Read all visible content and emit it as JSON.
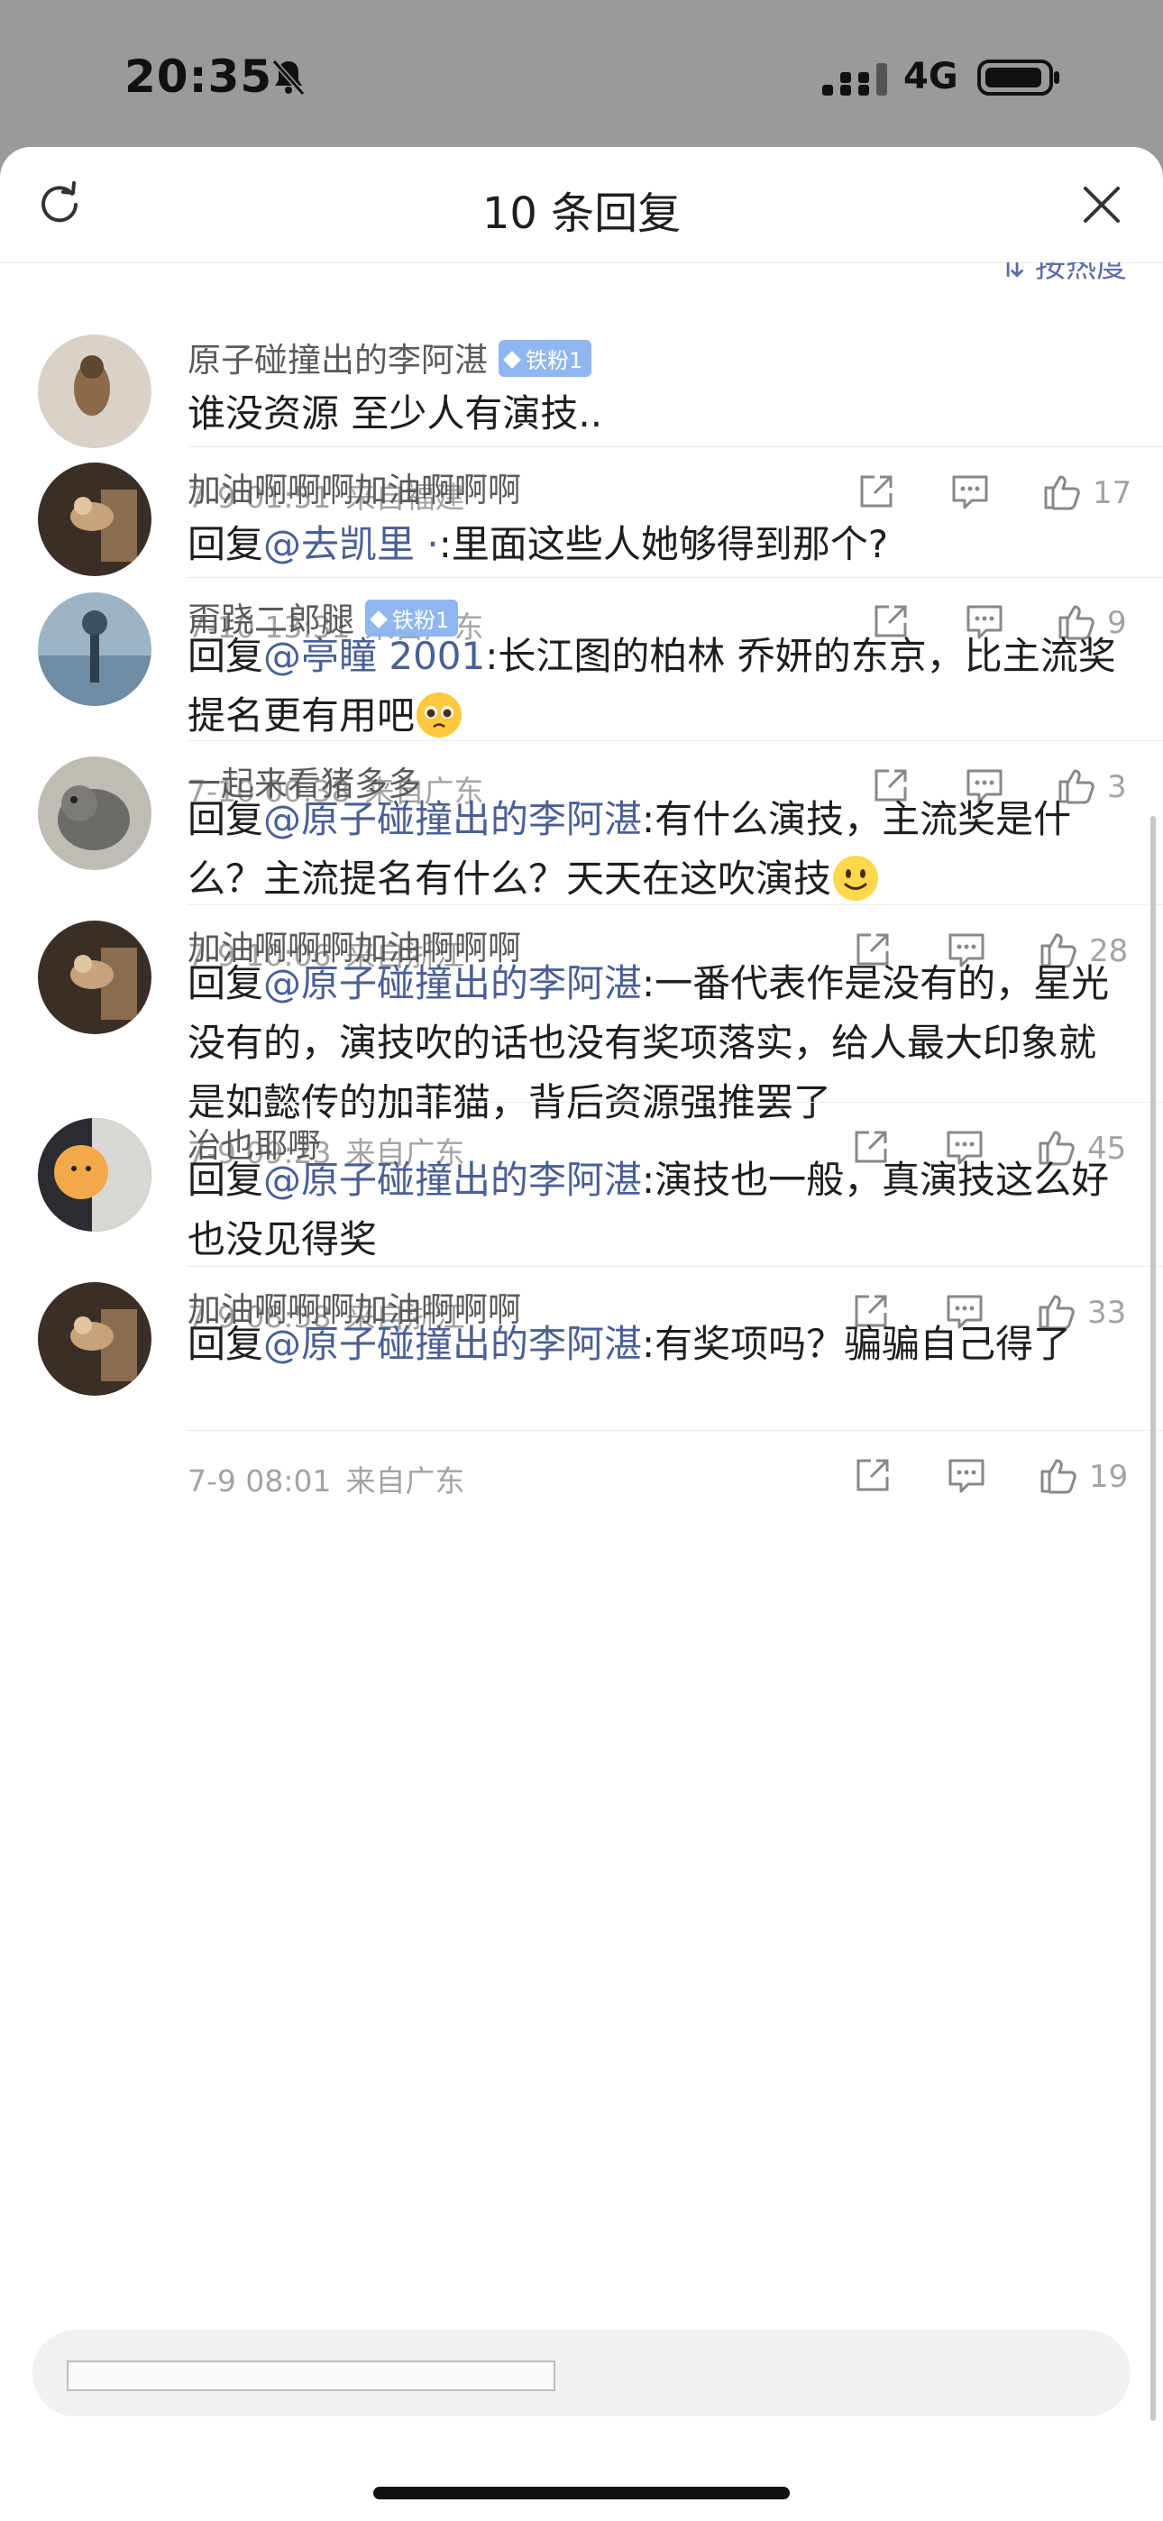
{
  "status": {
    "time": "20:35",
    "network": "4G"
  },
  "sheet": {
    "title": "10 条回复",
    "sort_label": "按热度"
  },
  "comments": [
    {
      "user": "原子碰撞出的李阿湛",
      "badge": "铁粉1",
      "prefix": "",
      "mention": "",
      "text": "谁没资源 至少人有演技..",
      "date": "7-9 01:51",
      "location": "来自福建",
      "likes": "17"
    },
    {
      "user": "加油啊啊啊加油啊啊啊",
      "badge": "",
      "prefix": "回复",
      "mention": "@去凯里 ·",
      "text": ":里面这些人她够得到那个?",
      "date": "7-10 13:31",
      "location": "来自广东",
      "likes": "9"
    },
    {
      "user": "甭跷二郎腿",
      "badge": "铁粉1",
      "prefix": "回复",
      "mention": "@亭瞳 2001",
      "text": ":长江图的柏林 乔妍的东京，比主流奖提名更有用吧",
      "emoji": "pleading-face-emoji",
      "date": "7-10 00:38",
      "location": "来自广东",
      "likes": "3"
    },
    {
      "user": "一起来看猪多多",
      "badge": "",
      "prefix": "回复",
      "mention": "@原子碰撞出的李阿湛",
      "text": ":有什么演技，主流奖是什么？主流提名有什么？天天在这吹演技",
      "emoji": "slight-smile-emoji",
      "date": "7-9 10:06",
      "location": "来自浙江",
      "likes": "28"
    },
    {
      "user": "加油啊啊啊加油啊啊啊",
      "badge": "",
      "prefix": "回复",
      "mention": "@原子碰撞出的李阿湛",
      "text": ":一番代表作是没有的，星光没有的，演技吹的话也没有奖项落实，给人最大印象就是如懿传的加菲猫，背后资源强推罢了",
      "date": "7-9 09:23",
      "location": "来自广东",
      "likes": "45"
    },
    {
      "user": "冶也耶嘢",
      "badge": "",
      "prefix": "回复",
      "mention": "@原子碰撞出的李阿湛",
      "text": ":演技也一般，真演技这么好也没见得奖",
      "date": "7-9 08:58",
      "location": "来自浙江",
      "likes": "33"
    },
    {
      "user": "加油啊啊啊加油啊啊啊",
      "badge": "",
      "prefix": "回复",
      "mention": "@原子碰撞出的李阿湛",
      "text": ":有奖项吗？骗骗自己得了",
      "date": "7-9 08:01",
      "location": "来自广东",
      "likes": "19"
    }
  ],
  "colors": {
    "mention": "#4a5f96",
    "badge": "#8fb6f0",
    "meta": "#a3a3a3"
  }
}
